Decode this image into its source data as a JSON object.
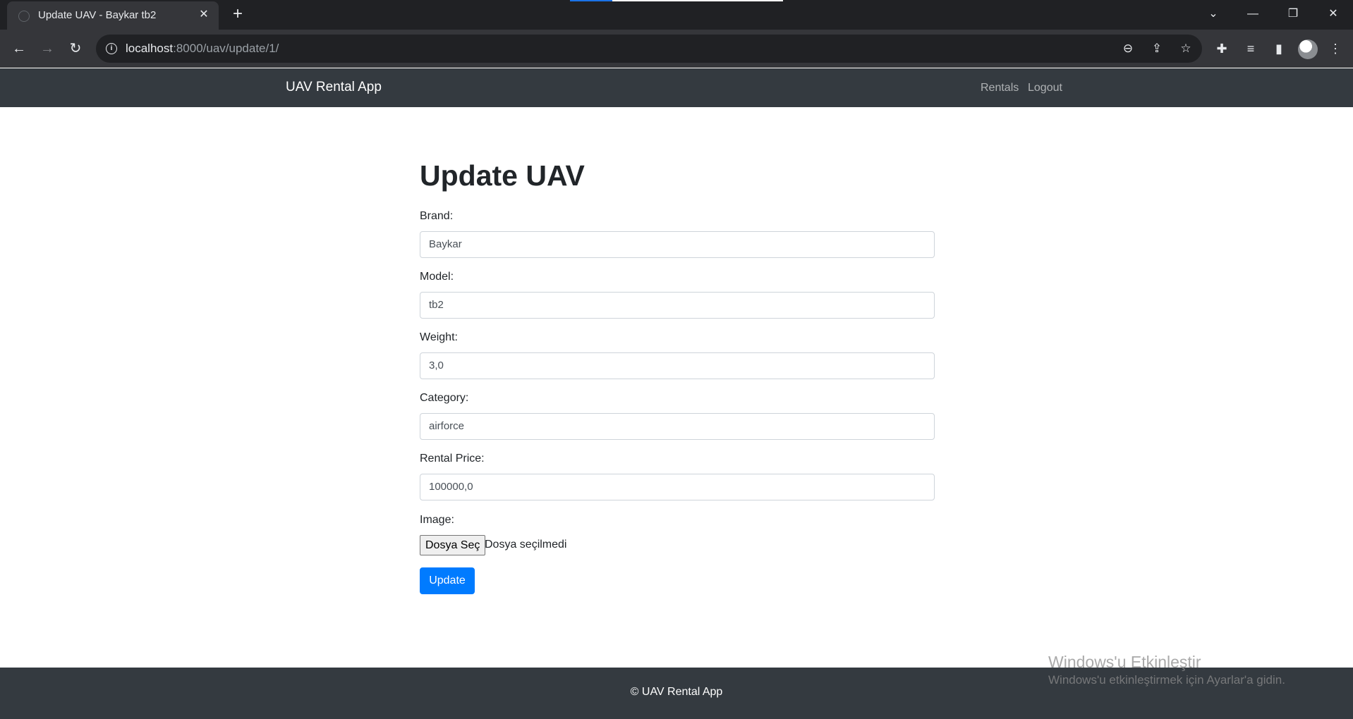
{
  "browser": {
    "tab_title": "Update UAV - Baykar tb2",
    "url_host": "localhost",
    "url_path": ":8000/uav/update/1/",
    "icons": {
      "favicon": "globe-icon",
      "close": "close-icon",
      "new_tab": "plus-icon",
      "back": "back-arrow-icon",
      "forward": "forward-arrow-icon",
      "reload": "reload-icon",
      "site_info": "info-icon",
      "zoom": "zoom-out-icon",
      "share": "share-icon",
      "bookmark": "star-icon",
      "extensions": "puzzle-icon",
      "media": "media-queue-icon",
      "side_panel": "side-panel-icon",
      "menu": "kebab-menu-icon"
    }
  },
  "navbar": {
    "brand": "UAV Rental App",
    "links": [
      "Rentals",
      "Logout"
    ]
  },
  "form": {
    "title": "Update UAV",
    "fields": [
      {
        "label": "Brand:",
        "value": "Baykar"
      },
      {
        "label": "Model:",
        "value": "tb2"
      },
      {
        "label": "Weight:",
        "value": "3,0"
      },
      {
        "label": "Category:",
        "value": "airforce"
      },
      {
        "label": "Rental Price:",
        "value": "100000,0"
      }
    ],
    "image_label": "Image:",
    "file_button": "Dosya Seç",
    "file_status": "Dosya seçilmedi",
    "submit": "Update"
  },
  "footer": {
    "text": "© UAV Rental App"
  },
  "watermark": {
    "title": "Windows'u Etkinleştir",
    "subtitle": "Windows'u etkinleştirmek için Ayarlar'a gidin."
  },
  "colors": {
    "navbar_bg": "#343a40",
    "primary": "#007bff",
    "chrome_dark": "#202124",
    "chrome_toolbar": "#35363a"
  }
}
